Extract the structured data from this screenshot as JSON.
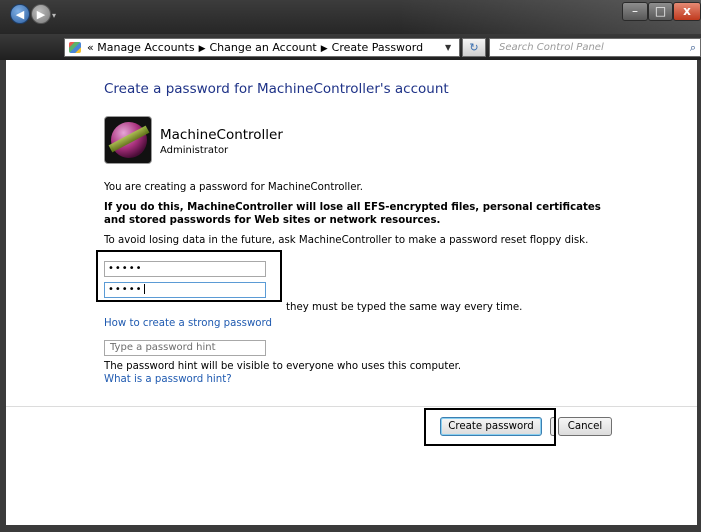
{
  "window": {
    "controls": {
      "minimize": "–",
      "maximize": "□",
      "close": "x"
    }
  },
  "nav": {
    "back_glyph": "◀",
    "forward_glyph": "▶",
    "history_dropdown": "▾",
    "breadcrumb_prefix": "«",
    "breadcrumbs": [
      "Manage Accounts",
      "Change an Account",
      "Create Password"
    ],
    "separator": "▶",
    "address_dropdown": "▼",
    "refresh_glyph": "↻",
    "search_placeholder": "Search Control Panel",
    "search_glyph": "⌕"
  },
  "main": {
    "title": "Create a password for MachineController's account",
    "account": {
      "name": "MachineController",
      "role": "Administrator",
      "icon": "user-avatar-icon"
    },
    "info_creating": "You are creating a password for MachineController.",
    "warning": "If you do this, MachineController will lose all EFS-encrypted files, personal certificates and stored passwords for Web sites or network resources.",
    "avoid_note": "To avoid losing data in the future, ask MachineController to make a password reset floppy disk.",
    "new_password_value": "•••••",
    "confirm_password_value": "•••••",
    "case_note_tail": "they must be typed the same way every time.",
    "link_strong": "How to create a strong password",
    "hint_placeholder": "Type a password hint",
    "hint_note": "The password hint will be visible to everyone who uses this computer.",
    "link_hint": "What is a password hint?",
    "create_button": "Create password",
    "cancel_button": "Cancel"
  },
  "colors": {
    "title_blue": "#1e3287",
    "link_blue": "#1f5ab0",
    "chrome_dark": "#262626",
    "close_red": "#c03a1e"
  }
}
